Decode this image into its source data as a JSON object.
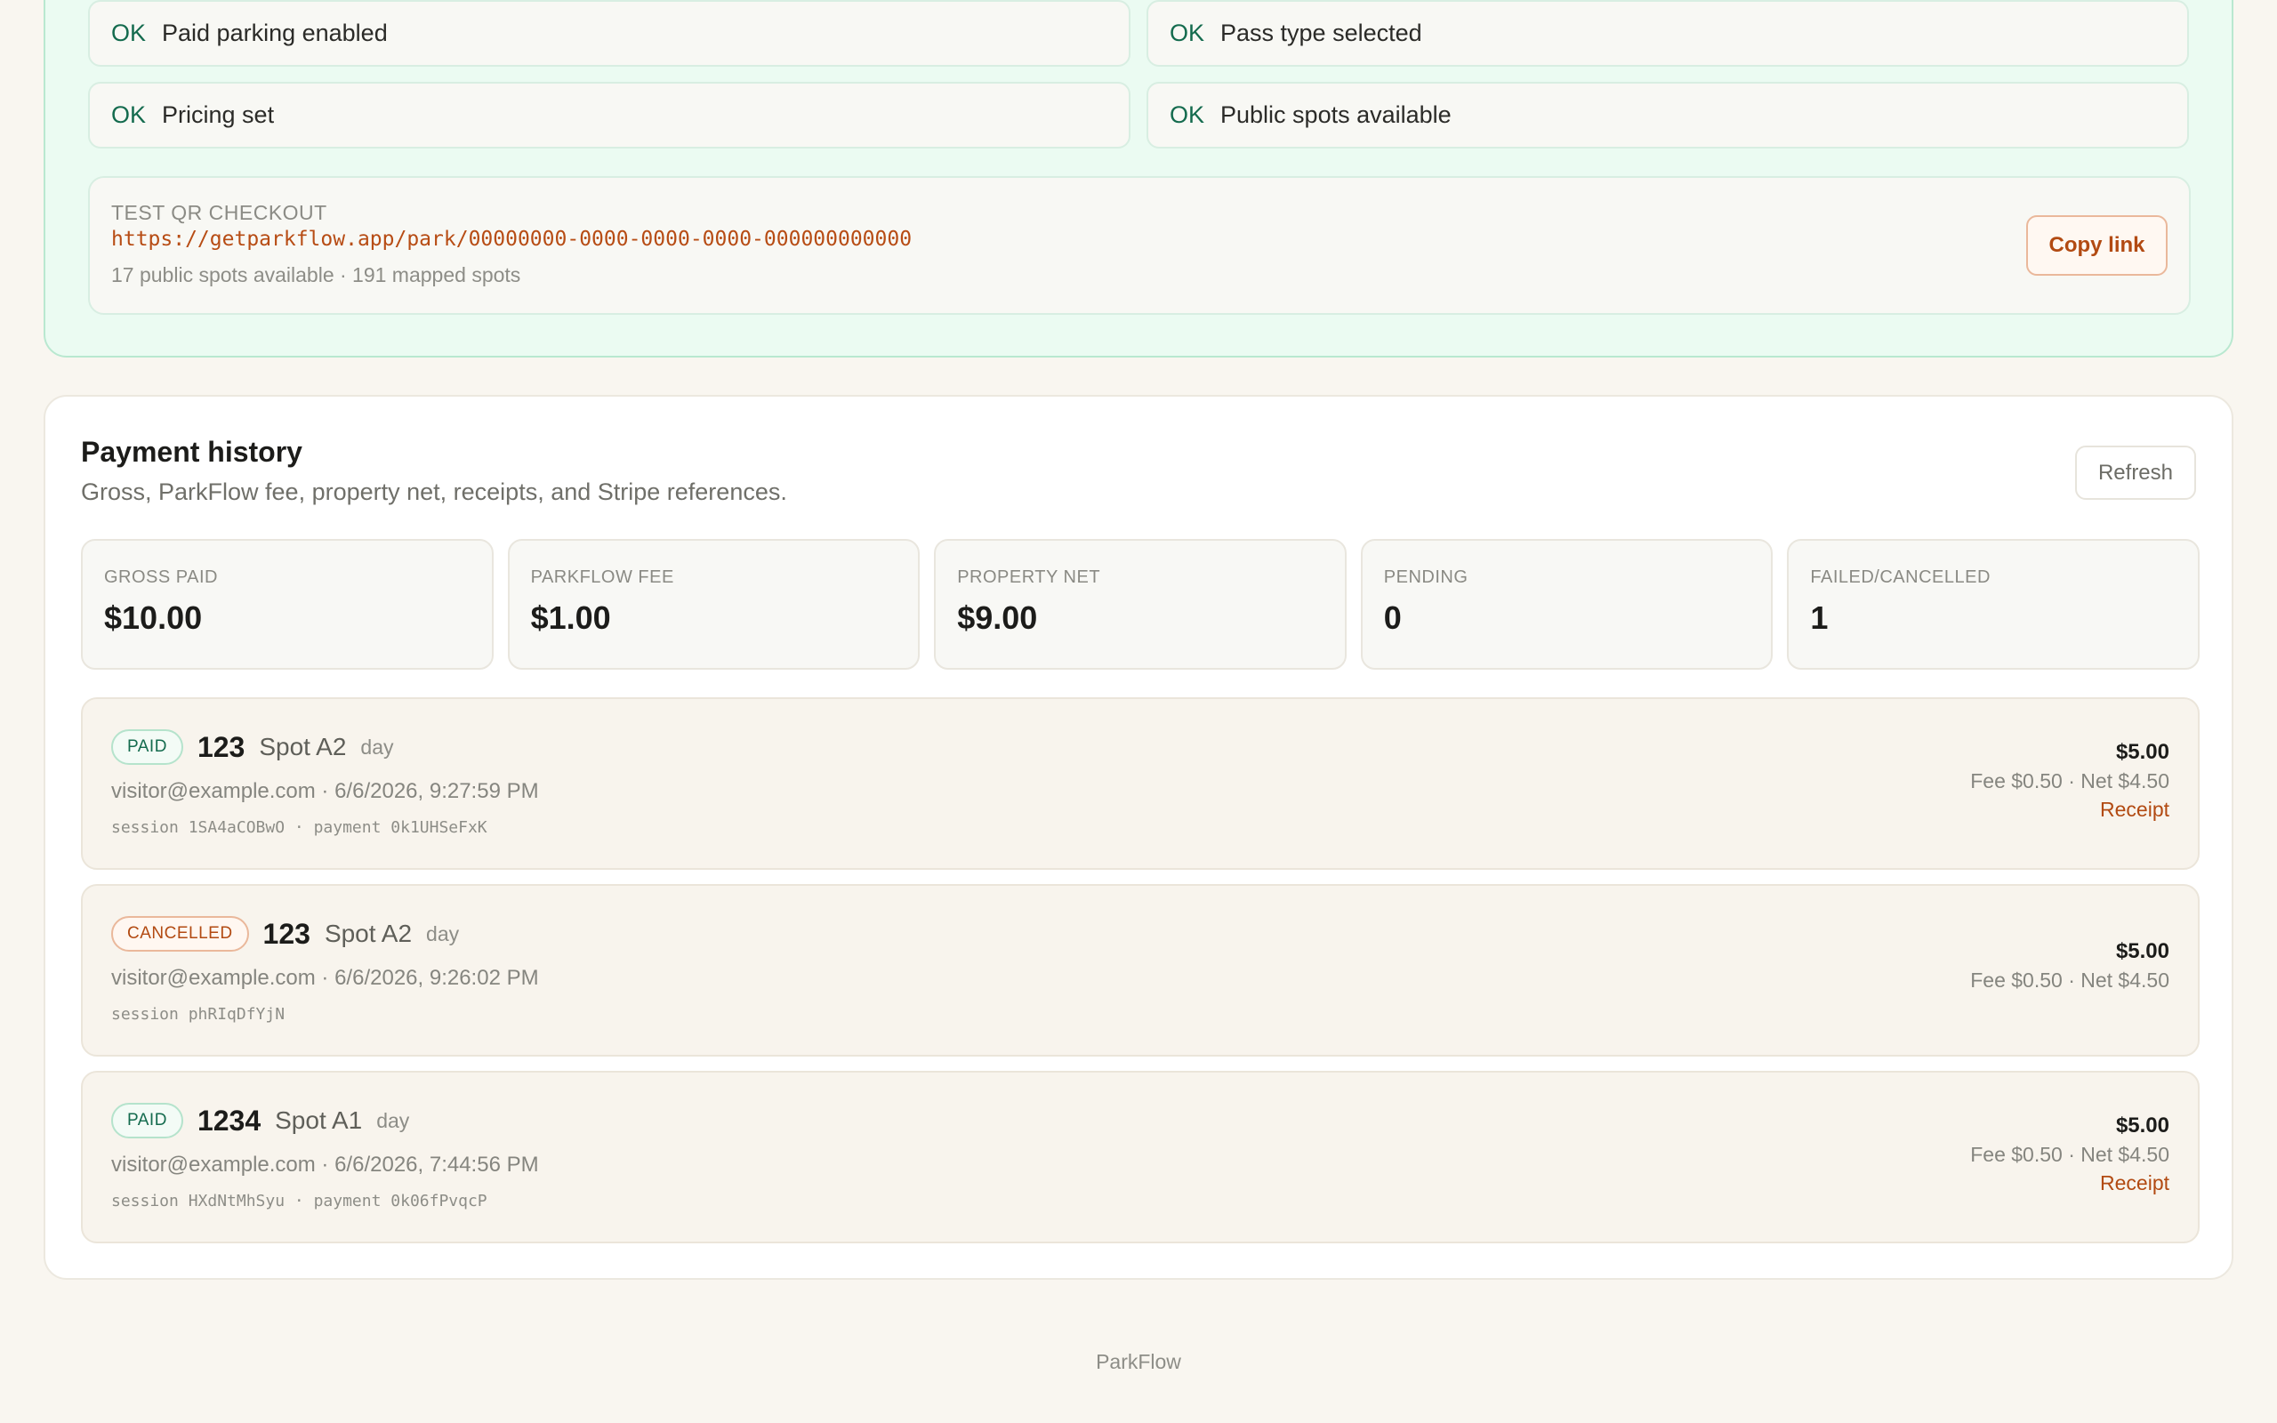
{
  "readiness": {
    "checks": [
      {
        "status": "OK",
        "label": "Paid parking enabled"
      },
      {
        "status": "OK",
        "label": "Pass type selected"
      },
      {
        "status": "OK",
        "label": "Pricing set"
      },
      {
        "status": "OK",
        "label": "Public spots available"
      }
    ],
    "qr_checkout": {
      "label": "TEST QR CHECKOUT",
      "url": "https://getparkflow.app/park/00000000-0000-0000-0000-000000000000",
      "meta": "17 public spots available · 191 mapped spots",
      "copy_label": "Copy link"
    }
  },
  "history": {
    "title": "Payment history",
    "subtitle": "Gross, ParkFlow fee, property net, receipts, and Stripe references.",
    "refresh_label": "Refresh",
    "stats": [
      {
        "label": "GROSS PAID",
        "value": "$10.00"
      },
      {
        "label": "PARKFLOW FEE",
        "value": "$1.00"
      },
      {
        "label": "PROPERTY NET",
        "value": "$9.00"
      },
      {
        "label": "PENDING",
        "value": "0"
      },
      {
        "label": "FAILED/CANCELLED",
        "value": "1"
      }
    ],
    "payments": [
      {
        "status": "PAID",
        "plate": "123",
        "spot": "Spot A2",
        "type": "day",
        "meta": "visitor@example.com · 6/6/2026, 9:27:59 PM",
        "ref": "session 1SA4aCOBwO · payment 0k1UHSeFxK",
        "amount": "$5.00",
        "fee_net": "Fee $0.50 · Net $4.50",
        "receipt": "Receipt"
      },
      {
        "status": "CANCELLED",
        "plate": "123",
        "spot": "Spot A2",
        "type": "day",
        "meta": "visitor@example.com · 6/6/2026, 9:26:02 PM",
        "ref": "session phRIqDfYjN",
        "amount": "$5.00",
        "fee_net": "Fee $0.50 · Net $4.50",
        "receipt": ""
      },
      {
        "status": "PAID",
        "plate": "1234",
        "spot": "Spot A1",
        "type": "day",
        "meta": "visitor@example.com · 6/6/2026, 7:44:56 PM",
        "ref": "session HXdNtMhSyu · payment 0k06fPvqcP",
        "amount": "$5.00",
        "fee_net": "Fee $0.50 · Net $4.50",
        "receipt": "Receipt"
      }
    ]
  },
  "footer": {
    "brand": "ParkFlow"
  },
  "colors": {
    "page_bg": "#f9f6f0",
    "ready_bg": "#ebfbf2",
    "ok_green": "#146b4e",
    "accent_orange": "#b24a12"
  }
}
